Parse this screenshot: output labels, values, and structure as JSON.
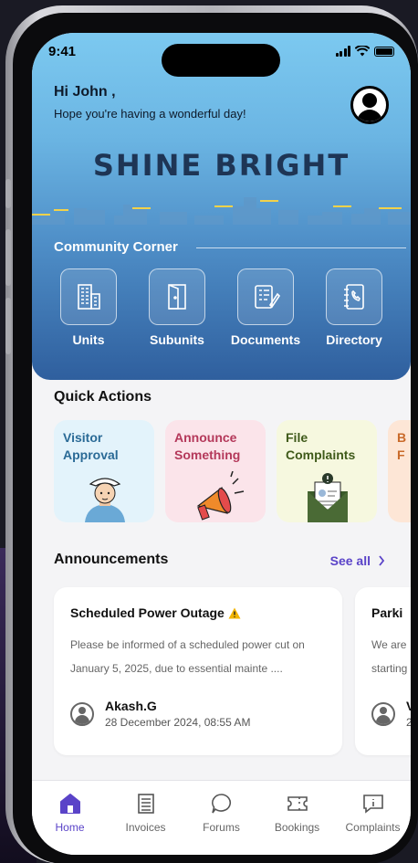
{
  "status": {
    "time": "9:41"
  },
  "greeting": {
    "title": "Hi John ,",
    "subtitle": "Hope you're having a wonderful day!"
  },
  "brand": {
    "name": "SHINE BRIGHT"
  },
  "community_corner": {
    "title": "Community Corner",
    "items": [
      {
        "label": "Units",
        "icon": "building-icon"
      },
      {
        "label": "Subunits",
        "icon": "door-icon"
      },
      {
        "label": "Documents",
        "icon": "document-icon"
      },
      {
        "label": "Directory",
        "icon": "phonebook-icon"
      }
    ]
  },
  "quick_actions": {
    "title": "Quick Actions",
    "cards": [
      {
        "line1": "Visitor",
        "line2": "Approval",
        "bg": "#e3f3fb",
        "color": "#2a6a96"
      },
      {
        "line1": "Announce",
        "line2": "Something",
        "bg": "#fbe4ea",
        "color": "#b4385a"
      },
      {
        "line1": "File",
        "line2": "Complaints",
        "bg": "#f6f8df",
        "color": "#3f5a1a"
      },
      {
        "line1": "B",
        "line2": "F",
        "bg": "#fde6d6",
        "color": "#c96a2a"
      }
    ]
  },
  "announcements": {
    "title": "Announcements",
    "see_all": "See all",
    "items": [
      {
        "title": "Scheduled Power Outage",
        "body": "Please be informed of a scheduled power cut on January 5, 2025, due to essential mainte ....",
        "author": "Akash.G",
        "date": "28 December 2024, 08:55 AM"
      },
      {
        "title": "Parki",
        "body": "We are starting",
        "author": "V",
        "date": "2"
      }
    ]
  },
  "tabbar": {
    "items": [
      {
        "label": "Home",
        "active": true
      },
      {
        "label": "Invoices",
        "active": false
      },
      {
        "label": "Forums",
        "active": false
      },
      {
        "label": "Bookings",
        "active": false
      },
      {
        "label": "Complaints",
        "active": false
      }
    ]
  },
  "colors": {
    "accent": "#5a43c8",
    "hero_top": "#7cc9f0",
    "hero_bottom": "#2f5f9e",
    "warning": "#f2b500"
  }
}
